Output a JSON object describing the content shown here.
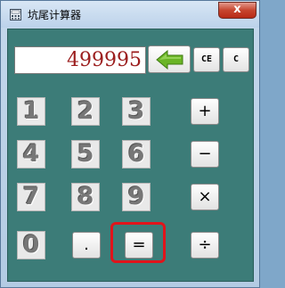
{
  "window": {
    "title": "坑尾计算器",
    "close_label": "x"
  },
  "calculator": {
    "display_value": "499995",
    "backspace_icon": "left-arrow-icon",
    "buttons": {
      "ce": "CE",
      "c": "C",
      "d1": "1",
      "d2": "2",
      "d3": "3",
      "d4": "4",
      "d5": "5",
      "d6": "6",
      "d7": "7",
      "d8": "8",
      "d9": "9",
      "d0": "0",
      "dot": ".",
      "equals": "=",
      "plus": "+",
      "minus": "−",
      "multiply": "×",
      "divide": "÷"
    }
  },
  "colors": {
    "panel": "#3c7c78",
    "display_text": "#9b1d1d",
    "arrow": "#6bb526",
    "highlight": "#e0141b"
  }
}
